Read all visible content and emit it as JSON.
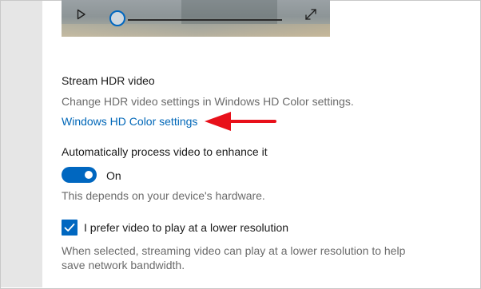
{
  "video_player": {
    "play_icon": "play-icon",
    "fullscreen_icon": "fullscreen-icon",
    "seek_position": 0
  },
  "hdr": {
    "heading": "Stream HDR video",
    "description": "Change HDR video settings in Windows HD Color settings.",
    "link_label": "Windows HD Color settings"
  },
  "auto_process": {
    "heading": "Automatically process video to enhance it",
    "toggle_state": "On",
    "toggle_on": true,
    "note": "This depends on your device's hardware."
  },
  "low_res": {
    "checkbox_label": "I prefer video to play at a lower resolution",
    "checked": true,
    "description_line1": "When selected, streaming video can play at a lower resolution to help",
    "description_line2": "save network bandwidth."
  },
  "colors": {
    "accent": "#0067c0",
    "link": "#0067b8",
    "annotation_arrow": "#e8101a"
  }
}
